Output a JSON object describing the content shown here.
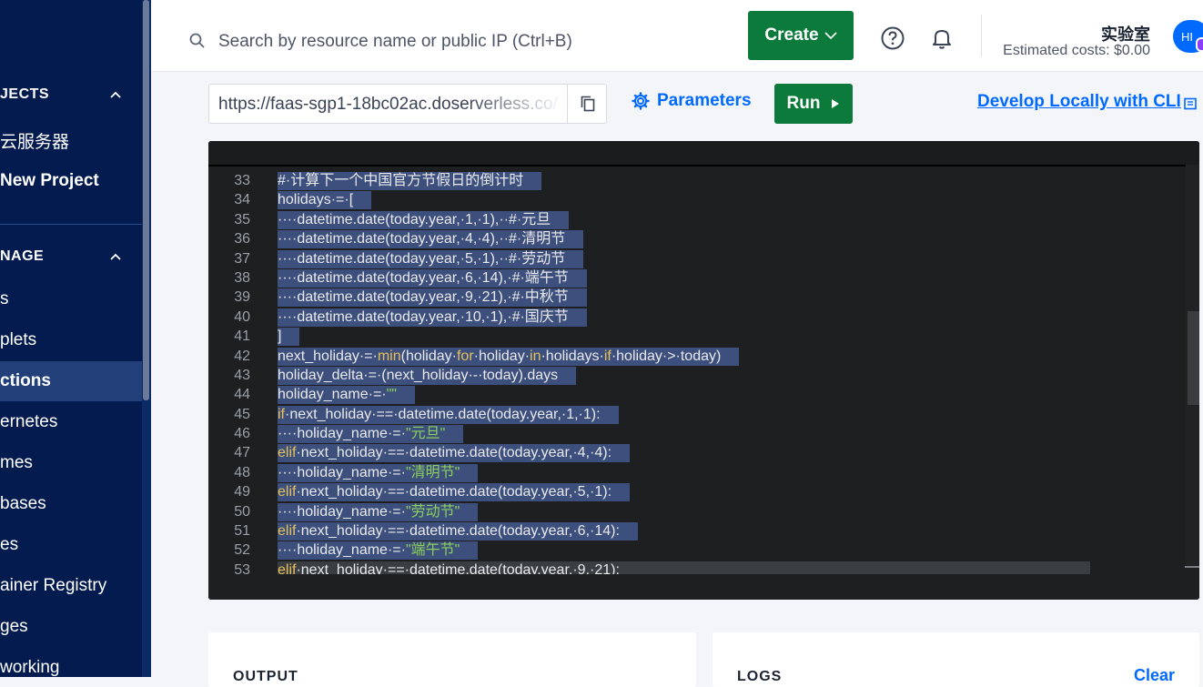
{
  "sidebar": {
    "projects_heading": "JECTS",
    "project_items": [
      "云服务器",
      "New Project"
    ],
    "manage_heading": "NAGE",
    "manage_items": [
      "s",
      "plets",
      "ctions",
      "ernetes",
      "mes",
      "bases",
      "es",
      "ainer Registry",
      "ges",
      "working"
    ],
    "active_item": "ctions"
  },
  "header": {
    "search_placeholder": "Search by resource name or public IP (Ctrl+B)",
    "create_label": "Create",
    "team_name": "实验室",
    "cost_text": "Estimated costs: $0.00",
    "avatar_initials": "HI"
  },
  "toolbar": {
    "url": "https://faas-sgp1-18bc02ac.doserverless.co/",
    "parameters_label": "Parameters",
    "run_label": "Run",
    "cli_label": "Develop Locally with CLI"
  },
  "editor": {
    "lines": [
      {
        "n": "33",
        "text": "#·计算下一个中国官方节假日的倒计时"
      },
      {
        "n": "34",
        "text": "holidays·=·["
      },
      {
        "n": "35",
        "text": "····datetime.date(today.year,·1,·1),··#·元旦"
      },
      {
        "n": "36",
        "text": "····datetime.date(today.year,·4,·4),··#·清明节"
      },
      {
        "n": "37",
        "text": "····datetime.date(today.year,·5,·1),··#·劳动节"
      },
      {
        "n": "38",
        "text": "····datetime.date(today.year,·6,·14),·#·端午节"
      },
      {
        "n": "39",
        "text": "····datetime.date(today.year,·9,·21),·#·中秋节"
      },
      {
        "n": "40",
        "text": "····datetime.date(today.year,·10,·1),·#·国庆节"
      },
      {
        "n": "41",
        "text": "]"
      },
      {
        "n": "42",
        "text": "next_holiday·=·min(holiday·for·holiday·in·holidays·if·holiday·>·today)"
      },
      {
        "n": "43",
        "text": "holiday_delta·=·(next_holiday·-·today).days"
      },
      {
        "n": "44",
        "text": "holiday_name·=·\"\""
      },
      {
        "n": "45",
        "text": "if·next_holiday·==·datetime.date(today.year,·1,·1):"
      },
      {
        "n": "46",
        "text": "····holiday_name·=·\"元旦\""
      },
      {
        "n": "47",
        "text": "elif·next_holiday·==·datetime.date(today.year,·4,·4):"
      },
      {
        "n": "48",
        "text": "····holiday_name·=·\"清明节\""
      },
      {
        "n": "49",
        "text": "elif·next_holiday·==·datetime.date(today.year,·5,·1):"
      },
      {
        "n": "50",
        "text": "····holiday_name·=·\"劳动节\""
      },
      {
        "n": "51",
        "text": "elif·next_holiday·==·datetime.date(today.year,·6,·14):"
      },
      {
        "n": "52",
        "text": "····holiday_name·=·\"端午节\""
      },
      {
        "n": "53",
        "text": "elif·next_holiday·==·datetime.date(today.year,·9,·21):"
      }
    ]
  },
  "panels": {
    "output_title": "OUTPUT",
    "logs_title": "LOGS",
    "clear_label": "Clear"
  },
  "colors": {
    "sidebar_bg": "#031b4e",
    "accent_blue": "#0069ff",
    "button_green": "#0c7a3a",
    "editor_bg": "#1d1f21",
    "selection": "#3d4f7c",
    "keyword": "#e6c15a",
    "string": "#8bd05a"
  }
}
